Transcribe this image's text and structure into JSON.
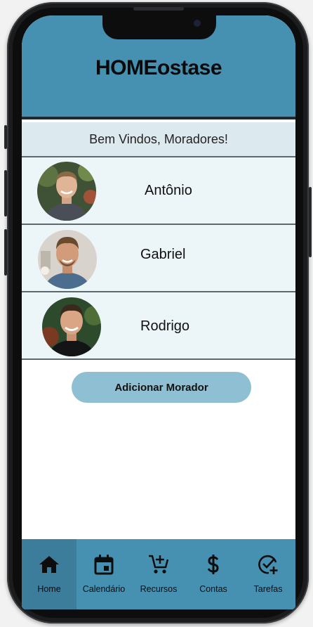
{
  "app": {
    "title": "HOMEostase"
  },
  "welcome": "Bem Vindos, Moradores!",
  "residents": [
    {
      "name": "Antônio",
      "avatar": "person-photo-icon"
    },
    {
      "name": "Gabriel",
      "avatar": "person-photo-icon"
    },
    {
      "name": "Rodrigo",
      "avatar": "person-photo-icon"
    }
  ],
  "actions": {
    "add_resident": "Adicionar Morador"
  },
  "tabs": [
    {
      "label": "Home",
      "icon": "home-icon",
      "active": true
    },
    {
      "label": "Calendário",
      "icon": "calendar-icon",
      "active": false
    },
    {
      "label": "Recursos",
      "icon": "cart-plus-icon",
      "active": false
    },
    {
      "label": "Contas",
      "icon": "dollar-icon",
      "active": false
    },
    {
      "label": "Tarefas",
      "icon": "task-check-icon",
      "active": false
    }
  ],
  "colors": {
    "primary": "#4691b2",
    "active_tab": "#3c7d9b",
    "button": "#8fbfd2",
    "row_bg": "#ecf6f9",
    "welcome_bg": "#dceaf0"
  }
}
